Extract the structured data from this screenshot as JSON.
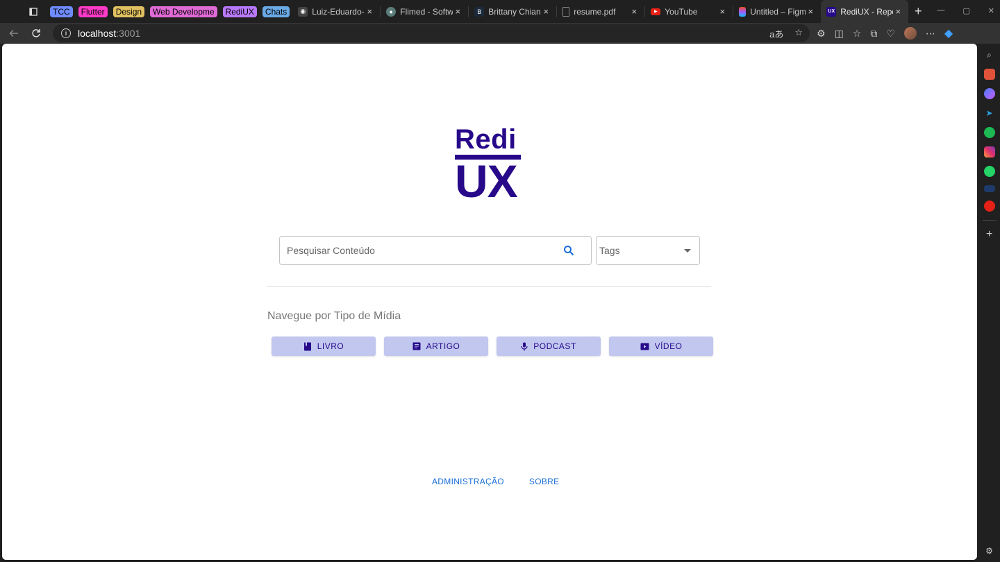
{
  "browser": {
    "tab_groups": [
      {
        "label": "TCC",
        "color": "#6f8cff"
      },
      {
        "label": "Flutter",
        "color": "#ff3ac8"
      },
      {
        "label": "Design",
        "color": "#e0c060"
      },
      {
        "label": "Web Developme",
        "color": "#e06ad6"
      },
      {
        "label": "RediUX",
        "color": "#b979ff"
      },
      {
        "label": "Chats",
        "color": "#6aa9e6"
      }
    ],
    "tabs": [
      {
        "title": "Luiz-Eduardo-F",
        "favicon_color": "#444",
        "favicon_glyph": "◉"
      },
      {
        "title": "Flimed - Softw",
        "favicon_color": "#5a7d7a",
        "favicon_glyph": "●"
      },
      {
        "title": "Brittany Chian",
        "favicon_color": "#1b2a3a",
        "favicon_glyph": "B"
      },
      {
        "title": "resume.pdf",
        "favicon_color": "#3a3a3a",
        "favicon_glyph": "▯"
      },
      {
        "title": "YouTube",
        "favicon_color": "#e62117",
        "favicon_glyph": "▶"
      },
      {
        "title": "Untitled – Figm",
        "favicon_color": "#a259ff",
        "favicon_glyph": "✦"
      },
      {
        "title": "RediUX - Repo",
        "favicon_color": "#27098a",
        "favicon_glyph": "UX"
      }
    ],
    "address": {
      "host": "localhost",
      "port": ":3001"
    }
  },
  "page": {
    "logo_top": "Redi",
    "logo_bottom": "UX",
    "search": {
      "placeholder": "Pesquisar Conteúdo"
    },
    "tags": {
      "label": "Tags"
    },
    "section_title": "Navegue por Tipo de Mídia",
    "media_buttons": [
      {
        "label": "LIVRO",
        "icon": "book-icon"
      },
      {
        "label": "ARTIGO",
        "icon": "article-icon"
      },
      {
        "label": "PODCAST",
        "icon": "mic-icon"
      },
      {
        "label": "VÍDEO",
        "icon": "video-icon"
      }
    ],
    "footer": {
      "admin": "ADMINISTRAÇÃO",
      "about": "SOBRE"
    }
  },
  "colors": {
    "brand": "#27098a",
    "button_bg": "#c1c7ef",
    "link": "#1a6ed8"
  }
}
